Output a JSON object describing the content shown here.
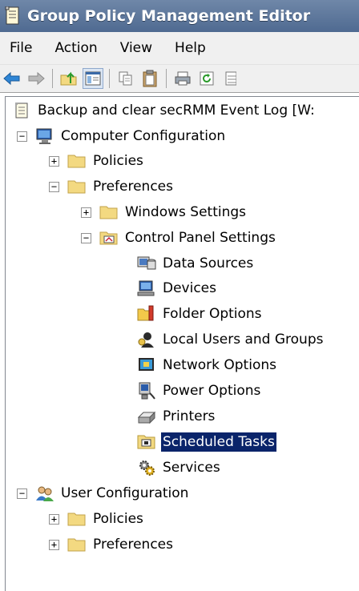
{
  "window": {
    "title": "Group Policy Management Editor"
  },
  "menu": [
    {
      "label": "File"
    },
    {
      "label": "Action"
    },
    {
      "label": "View"
    },
    {
      "label": "Help"
    }
  ],
  "toolbar": {
    "buttons": [
      "back-icon",
      "forward-icon",
      "up-folder-icon",
      "show-hide-tree-icon",
      "copy-icon",
      "paste-icon",
      "print-icon",
      "refresh-icon",
      "export-list-icon"
    ]
  },
  "tree": {
    "root": {
      "label": "Backup and clear secRMM Event Log [W:"
    },
    "computer_config": {
      "label": "Computer Configuration",
      "expander": "−"
    },
    "cc_policies": {
      "label": "Policies",
      "expander": "+"
    },
    "cc_preferences": {
      "label": "Preferences",
      "expander": "−"
    },
    "windows_settings": {
      "label": "Windows Settings",
      "expander": "+"
    },
    "control_panel_settings": {
      "label": "Control Panel Settings",
      "expander": "−"
    },
    "cp_items": [
      {
        "label": "Data Sources"
      },
      {
        "label": "Devices"
      },
      {
        "label": "Folder Options"
      },
      {
        "label": "Local Users and Groups"
      },
      {
        "label": "Network Options"
      },
      {
        "label": "Power Options"
      },
      {
        "label": "Printers"
      },
      {
        "label": "Scheduled Tasks",
        "selected": true
      },
      {
        "label": "Services"
      }
    ],
    "user_config": {
      "label": "User Configuration",
      "expander": "−"
    },
    "uc_policies": {
      "label": "Policies",
      "expander": "+"
    },
    "uc_preferences": {
      "label": "Preferences",
      "expander": "+"
    }
  },
  "colors": {
    "selection": "#0a246a",
    "titlebar": "#5a7398",
    "folder": "#f3d981"
  }
}
